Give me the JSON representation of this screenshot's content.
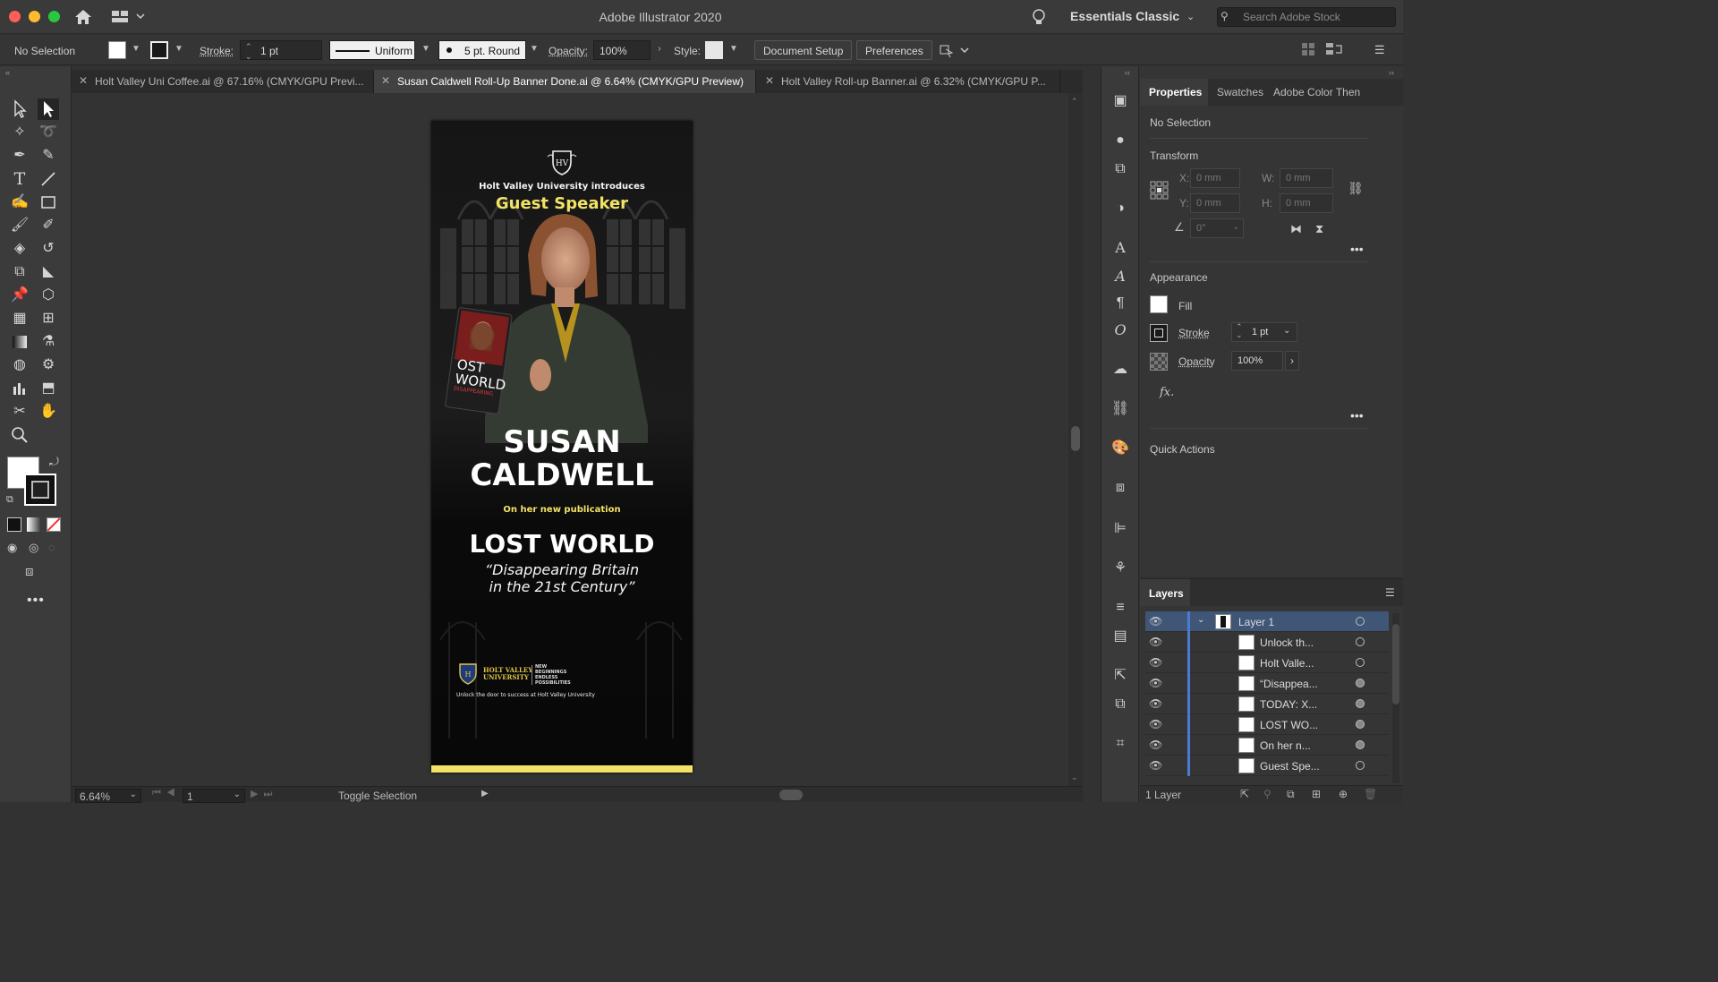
{
  "app": {
    "title": "Adobe Illustrator 2020",
    "workspace": "Essentials Classic",
    "search_placeholder": "Search Adobe Stock"
  },
  "control_bar": {
    "selection": "No Selection",
    "stroke_label": "Stroke:",
    "stroke_value": "1 pt",
    "profile": "Uniform",
    "brush": "5 pt. Round",
    "opacity_label": "Opacity:",
    "opacity_value": "100%",
    "style_label": "Style:",
    "document_setup": "Document Setup",
    "preferences": "Preferences"
  },
  "tabs": [
    {
      "label": "Holt Valley Uni Coffee.ai @ 67.16% (CMYK/GPU Previ...",
      "active": false
    },
    {
      "label": "Susan Caldwell Roll-Up Banner Done.ai @ 6.64% (CMYK/GPU Preview)",
      "active": true
    },
    {
      "label": "Holt Valley Roll-up Banner.ai @ 6.32% (CMYK/GPU P...",
      "active": false
    }
  ],
  "banner": {
    "intro": "Holt Valley University introduces",
    "guest": "Guest Speaker",
    "book_title_1": "OST",
    "book_title_2": "WORLD",
    "book_sub": "DISAPPEARING",
    "name_1": "SUSAN",
    "name_2": "CALDWELL",
    "publication": "On her new publication",
    "book": "LOST WORLD",
    "subtitle_1": "“Disappearing Britain",
    "subtitle_2": "in the 21st Century”",
    "logo_name_1": "HOLT VALLEY",
    "logo_name_2": "UNIVERSITY",
    "tagline_1": "NEW",
    "tagline_2": "BEGINNINGS",
    "tagline_3": "ENDLESS",
    "tagline_4": "POSSIBILITIES",
    "footer": "Unlock the door to success at Holt Valley University",
    "crest": "H",
    "crest_small": "HV"
  },
  "status": {
    "zoom": "6.64%",
    "page": "1",
    "toggle": "Toggle Selection"
  },
  "properties": {
    "tabs": [
      "Properties",
      "Swatches",
      "Adobe Color Then"
    ],
    "no_selection": "No Selection",
    "transform": "Transform",
    "x_label": "X:",
    "y_label": "Y:",
    "w_label": "W:",
    "h_label": "H:",
    "x_value": "0 mm",
    "y_value": "0 mm",
    "w_value": "0 mm",
    "h_value": "0 mm",
    "angle_value": "0°",
    "appearance": "Appearance",
    "fill": "Fill",
    "stroke": "Stroke",
    "stroke_value": "1 pt",
    "opacity": "Opacity",
    "opacity_value": "100%",
    "fx": "fx.",
    "quick_actions": "Quick Actions"
  },
  "layers": {
    "title": "Layers",
    "layer_name": "Layer 1",
    "items": [
      "Unlock th...",
      "Holt Valle...",
      "“Disappea...",
      "TODAY: X...",
      "LOST WO...",
      "On her n...",
      "Guest Spe..."
    ],
    "footer": "1 Layer"
  },
  "colors": {
    "accent_yellow": "#f2e266",
    "selected_row": "#3f5677"
  }
}
